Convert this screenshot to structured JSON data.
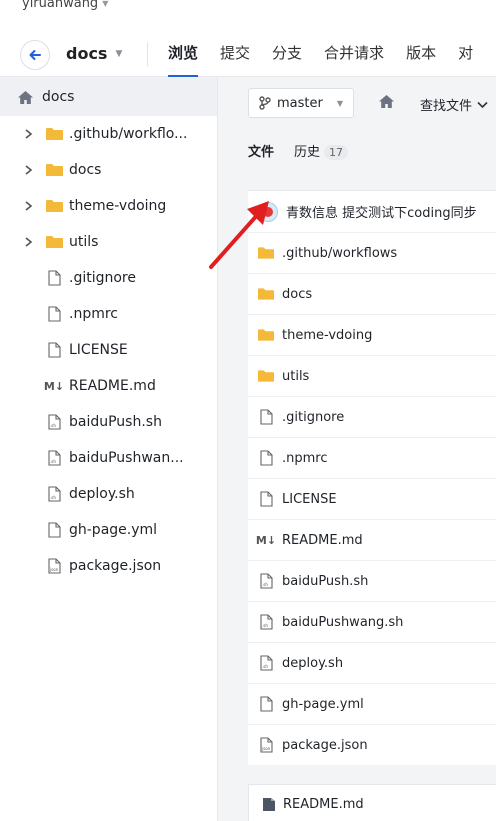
{
  "top": {
    "username": "yiruanwang"
  },
  "header": {
    "repo_name": "docs",
    "tabs": [
      "浏览",
      "提交",
      "分支",
      "合并请求",
      "版本",
      "对"
    ]
  },
  "sidebar": {
    "root_label": "docs",
    "items": [
      {
        "label": ".github/workflo...",
        "type": "folder"
      },
      {
        "label": "docs",
        "type": "folder"
      },
      {
        "label": "theme-vdoing",
        "type": "folder"
      },
      {
        "label": "utils",
        "type": "folder"
      },
      {
        "label": ".gitignore",
        "type": "file"
      },
      {
        "label": ".npmrc",
        "type": "file"
      },
      {
        "label": "LICENSE",
        "type": "file"
      },
      {
        "label": "README.md",
        "type": "markdown"
      },
      {
        "label": "baiduPush.sh",
        "type": "shell"
      },
      {
        "label": "baiduPushwan...",
        "type": "shell"
      },
      {
        "label": "deploy.sh",
        "type": "shell"
      },
      {
        "label": "gh-page.yml",
        "type": "file"
      },
      {
        "label": "package.json",
        "type": "json"
      }
    ]
  },
  "main": {
    "branch": "master",
    "find_files": "查找文件",
    "subtabs": {
      "files": "文件",
      "history": "历史",
      "history_count": "17"
    },
    "commit_message": "青数信息 提交测试下coding同步",
    "files": [
      {
        "name": ".github/workflows",
        "type": "folder"
      },
      {
        "name": "docs",
        "type": "folder"
      },
      {
        "name": "theme-vdoing",
        "type": "folder"
      },
      {
        "name": "utils",
        "type": "folder"
      },
      {
        "name": ".gitignore",
        "type": "file"
      },
      {
        "name": ".npmrc",
        "type": "file"
      },
      {
        "name": "LICENSE",
        "type": "file"
      },
      {
        "name": "README.md",
        "type": "markdown"
      },
      {
        "name": "baiduPush.sh",
        "type": "shell"
      },
      {
        "name": "baiduPushwang.sh",
        "type": "shell"
      },
      {
        "name": "deploy.sh",
        "type": "shell"
      },
      {
        "name": "gh-page.yml",
        "type": "file"
      },
      {
        "name": "package.json",
        "type": "json"
      }
    ],
    "readme_title": "README.md"
  },
  "colors": {
    "accent": "#1f62d8",
    "folder": "#f5b93a",
    "arrow": "#e02020"
  }
}
